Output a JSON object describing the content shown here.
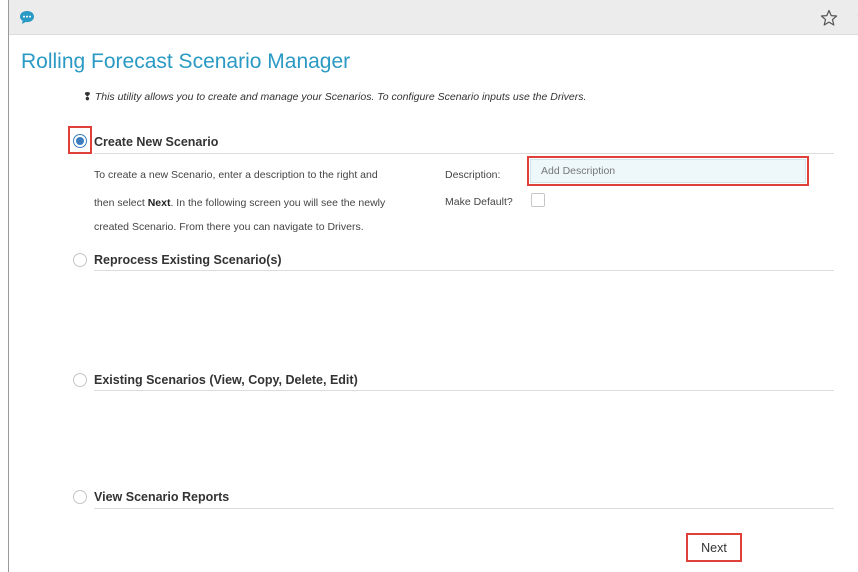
{
  "topbar": {
    "icons": [
      "chat-bubble-icon",
      "star-icon",
      "help-icon"
    ],
    "help_glyph": "?"
  },
  "page": {
    "title": "Rolling Forecast Scenario Manager",
    "info_text": "This utility allows you to create and manage your Scenarios. To configure Scenario inputs use the Drivers."
  },
  "sections": {
    "create": {
      "label": "Create New Scenario",
      "selected": true,
      "instructions": {
        "line1": "To create a new Scenario, enter a description to the right and",
        "line2_pre": "then select ",
        "line2_bold": "Next",
        "line2_post": ". In the following screen you will see the newly",
        "line3": "created Scenario. From there you can navigate to Drivers."
      },
      "description_label": "Description:",
      "description_placeholder": "Add Description",
      "description_value": "",
      "make_default_label": "Make Default?",
      "make_default_checked": false
    },
    "reprocess": {
      "label": "Reprocess Existing Scenario(s)",
      "selected": false
    },
    "existing": {
      "label": "Existing Scenarios (View, Copy, Delete, Edit)",
      "selected": false
    },
    "reports": {
      "label": "View Scenario Reports",
      "selected": false
    }
  },
  "footer": {
    "next_label": "Next"
  },
  "colors": {
    "title": "#2a9ac4",
    "radio_selected": "#3a7ebf",
    "highlight": "#e0403a",
    "input_bg": "#eef8fb",
    "topbar_bg": "#ececec"
  }
}
